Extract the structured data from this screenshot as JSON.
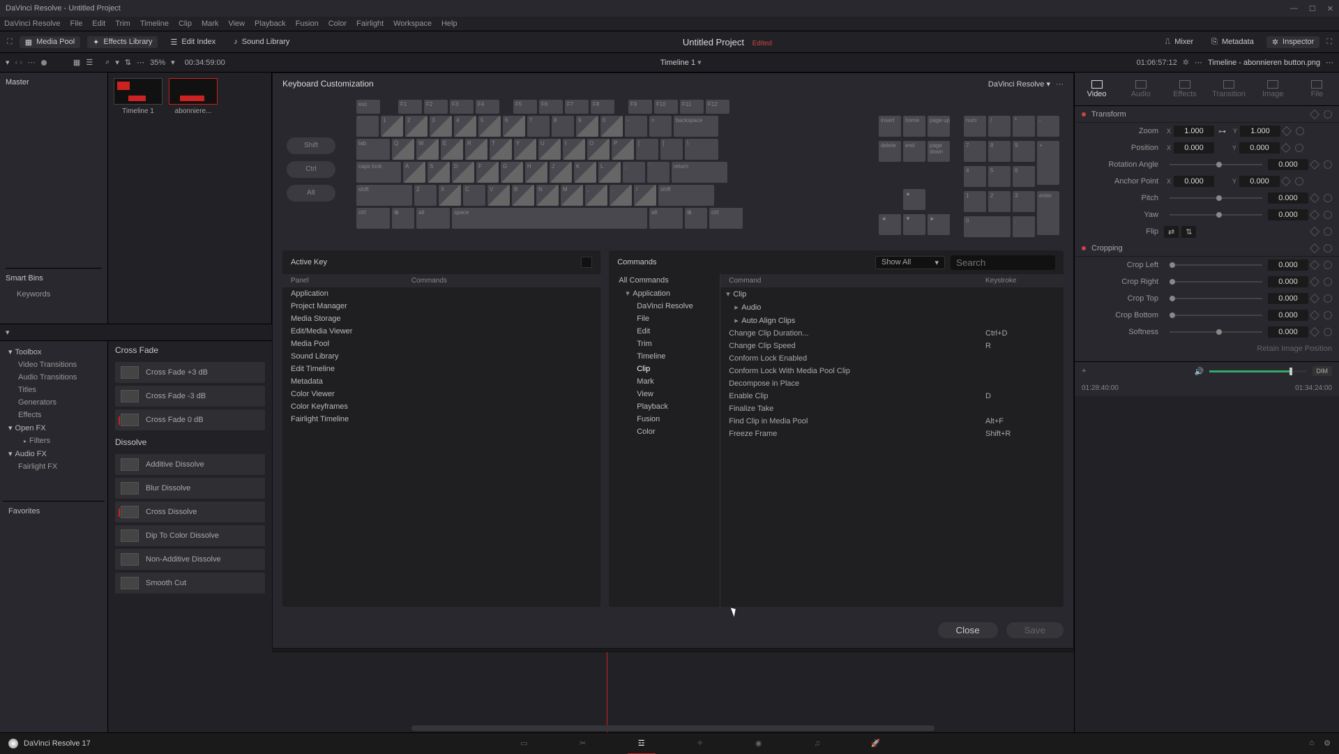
{
  "titlebar": {
    "title": "DaVinci Resolve - Untitled Project"
  },
  "menubar": [
    "DaVinci Resolve",
    "File",
    "Edit",
    "Trim",
    "Timeline",
    "Clip",
    "Mark",
    "View",
    "Playback",
    "Fusion",
    "Color",
    "Fairlight",
    "Workspace",
    "Help"
  ],
  "toolbar": {
    "media_pool": "Media Pool",
    "effects_library": "Effects Library",
    "edit_index": "Edit Index",
    "sound_library": "Sound Library",
    "project_title": "Untitled Project",
    "edited": "Edited",
    "mixer": "Mixer",
    "metadata": "Metadata",
    "inspector": "Inspector"
  },
  "subbar": {
    "zoom": "35%",
    "tc_left": "00:34:59:00",
    "timeline_name": "Timeline 1",
    "tc_right": "01:06:57:12",
    "clip_name": "Timeline - abonnieren button.png"
  },
  "media": {
    "master": "Master",
    "thumbs": [
      {
        "label": "Timeline 1"
      },
      {
        "label": "abonniere..."
      }
    ],
    "smartbins": "Smart Bins",
    "keywords": "Keywords"
  },
  "fx_tree": {
    "toolbox": "Toolbox",
    "video_trans": "Video Transitions",
    "audio_trans": "Audio Transitions",
    "titles": "Titles",
    "generators": "Generators",
    "effects": "Effects",
    "openfx": "Open FX",
    "filters": "Filters",
    "audiofx": "Audio FX",
    "fairlightfx": "Fairlight FX",
    "favorites": "Favorites"
  },
  "fx_groups": [
    {
      "name": "Cross Fade",
      "items": [
        "Cross Fade +3 dB",
        "Cross Fade -3 dB",
        "Cross Fade 0 dB"
      ]
    },
    {
      "name": "Dissolve",
      "items": [
        "Additive Dissolve",
        "Blur Dissolve",
        "Cross Dissolve",
        "Dip To Color Dissolve",
        "Non-Additive Dissolve",
        "Smooth Cut"
      ]
    }
  ],
  "modal": {
    "title": "Keyboard Customization",
    "preset": "DaVinci Resolve",
    "modifiers": [
      "Shift",
      "Ctrl",
      "Alt"
    ],
    "fn_row": [
      "esc",
      "F1",
      "F2",
      "F3",
      "F4",
      "F5",
      "F6",
      "F7",
      "F8",
      "F9",
      "F10",
      "F11",
      "F12"
    ],
    "num_row": [
      "`",
      "1",
      "2",
      "3",
      "4",
      "5",
      "6",
      "7",
      "8",
      "9",
      "0",
      "-",
      "=",
      "backspace"
    ],
    "qwer_row": [
      "tab",
      "Q",
      "W",
      "E",
      "R",
      "T",
      "Y",
      "U",
      "I",
      "O",
      "P",
      "[",
      "]",
      "\\"
    ],
    "asdf_row": [
      "caps lock",
      "A",
      "S",
      "D",
      "F",
      "G",
      "H",
      "J",
      "K",
      "L",
      ";",
      "'",
      "return"
    ],
    "zxcv_row": [
      "shift",
      "Z",
      "X",
      "C",
      "V",
      "B",
      "N",
      "M",
      ",",
      ".",
      "/",
      "shift"
    ],
    "bottom_row": [
      "ctrl",
      "",
      "alt",
      "space",
      "alt",
      "",
      "ctrl"
    ],
    "nav_top": [
      "insert",
      "home",
      "page up"
    ],
    "nav_mid": [
      "delete",
      "end",
      "page down"
    ],
    "numpad_top": [
      "num",
      "/",
      "*",
      "-"
    ],
    "active_key_title": "Active Key",
    "active_headers": [
      "Panel",
      "Commands"
    ],
    "active_panels": [
      "Application",
      "Project Manager",
      "Media Storage",
      "Edit/Media Viewer",
      "Media Pool",
      "Sound Library",
      "Edit Timeline",
      "Metadata",
      "Color Viewer",
      "Color Keyframes",
      "Fairlight Timeline"
    ],
    "commands_title": "Commands",
    "show_all": "Show All",
    "search_ph": "Search",
    "cmd_headers": [
      "Command",
      "Keystroke"
    ],
    "tree": {
      "all": "All Commands",
      "app": "Application",
      "items": [
        "DaVinci Resolve",
        "File",
        "Edit",
        "Trim",
        "Timeline",
        "Clip",
        "Mark",
        "View",
        "Playback",
        "Fusion",
        "Color"
      ]
    },
    "clip_hdr": "Clip",
    "audio": "Audio",
    "auto_align": "Auto Align Clips",
    "shortcuts": [
      {
        "cmd": "Change Clip Duration...",
        "key": "Ctrl+D"
      },
      {
        "cmd": "Change Clip Speed",
        "key": "R"
      },
      {
        "cmd": "Conform Lock Enabled",
        "key": ""
      },
      {
        "cmd": "Conform Lock With Media Pool Clip",
        "key": ""
      },
      {
        "cmd": "Decompose in Place",
        "key": ""
      },
      {
        "cmd": "Enable Clip",
        "key": "D"
      },
      {
        "cmd": "Finalize Take",
        "key": ""
      },
      {
        "cmd": "Find Clip in Media Pool",
        "key": "Alt+F"
      },
      {
        "cmd": "Freeze Frame",
        "key": "Shift+R"
      }
    ],
    "close": "Close",
    "save": "Save"
  },
  "inspector": {
    "tabs": [
      "Video",
      "Audio",
      "Effects",
      "Transition",
      "Image",
      "File"
    ],
    "transform": "Transform",
    "zoom_lbl": "Zoom",
    "zoom_x": "1.000",
    "zoom_y": "1.000",
    "pos_lbl": "Position",
    "pos_x": "0.000",
    "pos_y": "0.000",
    "rot_lbl": "Rotation Angle",
    "rot": "0.000",
    "anchor_lbl": "Anchor Point",
    "anchor_x": "0.000",
    "anchor_y": "0.000",
    "pitch_lbl": "Pitch",
    "pitch": "0.000",
    "yaw_lbl": "Yaw",
    "yaw": "0.000",
    "flip_lbl": "Flip",
    "cropping": "Cropping",
    "crop_left_lbl": "Crop Left",
    "crop_left": "0.000",
    "crop_right_lbl": "Crop Right",
    "crop_right": "0.000",
    "crop_top_lbl": "Crop Top",
    "crop_top": "0.000",
    "crop_bottom_lbl": "Crop Bottom",
    "crop_bottom": "0.000",
    "softness_lbl": "Softness",
    "softness": "0.000",
    "retain": "Retain Image Position",
    "dim": "DIM",
    "ruler_left": "01:28:40:00",
    "ruler_right": "01:34:24:00"
  },
  "bottom": {
    "app": "DaVinci Resolve 17"
  }
}
